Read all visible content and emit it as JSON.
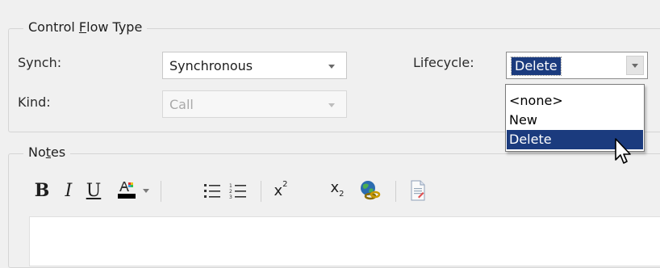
{
  "control_flow_group": {
    "title_pre": "Control ",
    "title_hot": "F",
    "title_post": "low Type",
    "synch": {
      "label": "Synch:",
      "value": "Synchronous"
    },
    "kind": {
      "label": "Kind:",
      "value": "Call"
    },
    "lifecycle": {
      "label": "Lifecycle:",
      "value": "Delete",
      "options": [
        "<none>",
        "New",
        "Delete"
      ],
      "selected_index": 2
    }
  },
  "notes_group": {
    "title_pre": "No",
    "title_hot": "t",
    "title_post": "es"
  },
  "toolbar": {
    "bold": "B",
    "italic": "I",
    "underline": "U",
    "superscript_base": "x",
    "superscript_exp": "2",
    "subscript_base": "x",
    "subscript_sub": "2"
  },
  "colors": {
    "selection": "#1b3b7e",
    "background": "#f0f0f0",
    "font_color_bar": "#000000"
  },
  "icons": [
    "font-color-icon",
    "bulleted-list-icon",
    "numbered-list-icon",
    "hyperlink-globe-icon",
    "document-icon",
    "mouse-pointer-icon"
  ]
}
